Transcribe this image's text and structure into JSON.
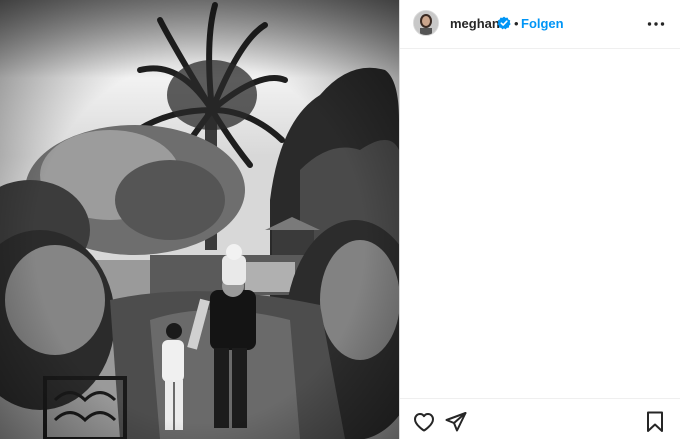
{
  "post": {
    "username": "meghan",
    "separator": "•",
    "follow_label": "Folgen"
  },
  "icons": {
    "verified": "verified-badge-icon",
    "more": "more-options-icon",
    "like": "heart-icon",
    "share": "paper-plane-icon",
    "save": "bookmark-icon"
  },
  "colors": {
    "accent": "#0095f6",
    "text": "#262626",
    "border": "#dbdbdb"
  }
}
